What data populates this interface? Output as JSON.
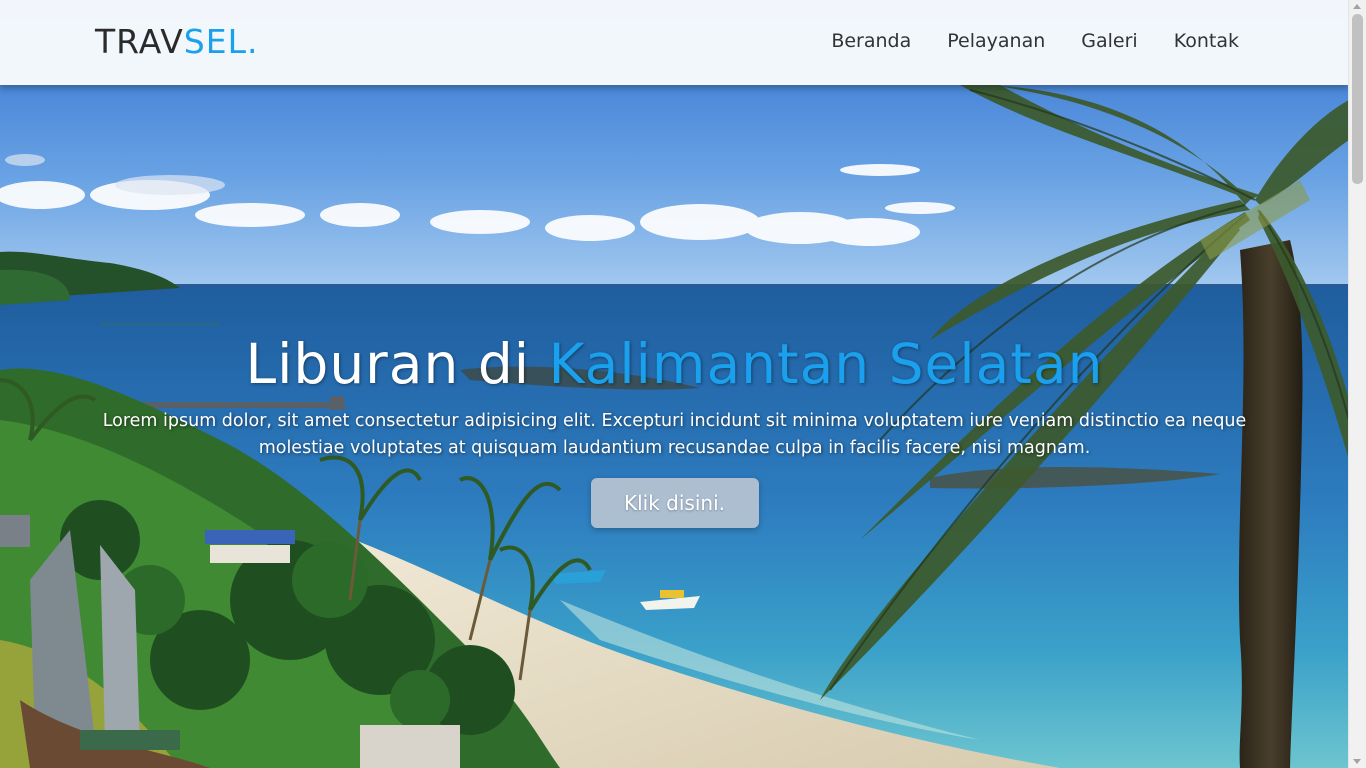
{
  "brand": {
    "prefix": "TRAV",
    "accent": "SEL."
  },
  "nav": {
    "items": [
      {
        "label": "Beranda"
      },
      {
        "label": "Pelayanan"
      },
      {
        "label": "Galeri"
      },
      {
        "label": "Kontak"
      }
    ]
  },
  "hero": {
    "title_prefix": "Liburan di ",
    "title_accent": "Kalimantan Selatan",
    "description": "Lorem ipsum dolor, sit amet consectetur adipisicing elit. Excepturi incidunt sit minima voluptatem iure veniam distinctio ea neque molestiae voluptates at quisquam laudantium recusandae culpa in facilis facere, nisi magnam.",
    "cta_label": "Klik disini."
  },
  "colors": {
    "accent": "#1aa0ec",
    "text_dark": "#2a2a2a",
    "navbar_bg": "#fafcfd"
  },
  "icons": {
    "scroll_up": "triangle-up-icon",
    "scroll_down": "triangle-down-icon"
  }
}
